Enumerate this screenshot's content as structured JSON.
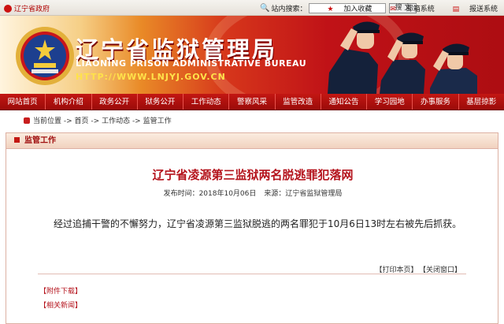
{
  "topbar": {
    "gov_link": "辽宁省政府",
    "search_label": "站内搜索：",
    "search_value": "",
    "search_button": "搜 文",
    "links": [
      "加入收藏",
      "邮箱系统",
      "报送系统"
    ]
  },
  "banner": {
    "title_cn": "辽宁省监狱管理局",
    "title_en": "LIAONING PRISON ADMINISTRATIVE BUREAU",
    "url": "HTTP://WWW.LNJYJ.GOV.CN"
  },
  "nav": [
    "网站首页",
    "机构介绍",
    "政务公开",
    "狱务公开",
    "工作动态",
    "警察风采",
    "监管改造",
    "通知公告",
    "学习园地",
    "办事服务",
    "基层掠影"
  ],
  "breadcrumb": {
    "current": "当前位置",
    "sep": " -> ",
    "items": [
      "首页",
      "工作动态",
      "监管工作"
    ]
  },
  "panel": {
    "heading": "监管工作"
  },
  "article": {
    "title": "辽宁省凌源第三监狱两名脱逃罪犯落网",
    "meta_time": "发布时间：2018年10月06日",
    "meta_source": "来源：辽宁省监狱管理局",
    "body": "经过追捕干警的不懈努力，辽宁省凌源第三监狱脱逃的两名罪犯于10月6日13时左右被先后抓获。",
    "print": "【打印本页】",
    "close": "【关闭窗口】"
  },
  "attachments": "【附件下载】",
  "related": "【相关新闻】"
}
